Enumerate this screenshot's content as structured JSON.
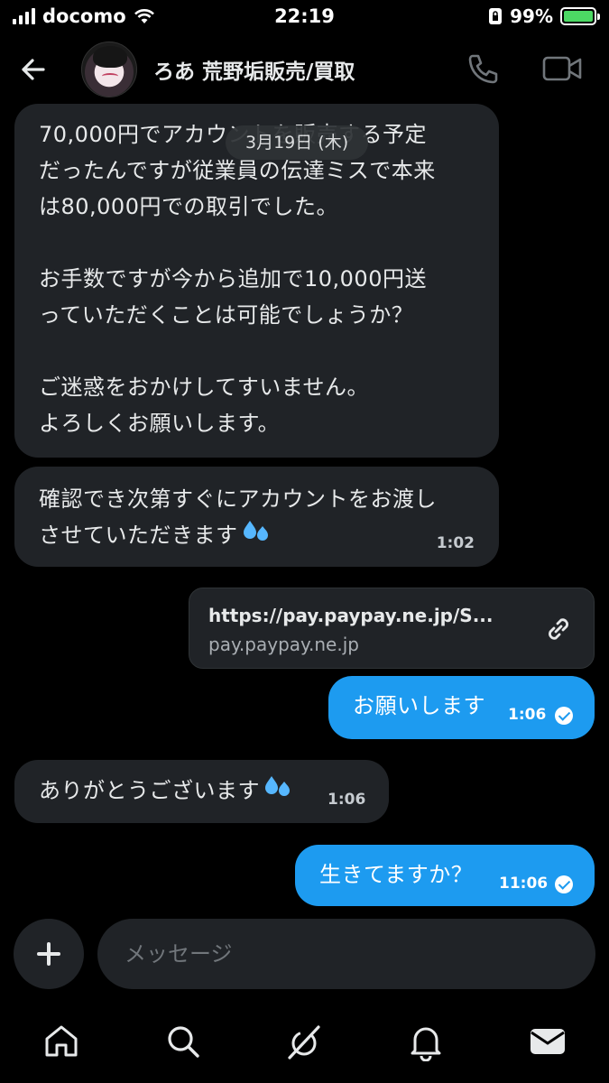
{
  "status_bar": {
    "carrier": "docomo",
    "time": "22:19",
    "battery_percent": "99%"
  },
  "header": {
    "title": "ろあ 荒野垢販売/買取",
    "avatar_icon": "avatar",
    "back_icon": "arrow-left-icon",
    "call_icon": "phone-icon",
    "video_icon": "video-camera-icon"
  },
  "date_separator": "3月19日 (木)",
  "messages": [
    {
      "direction": "incoming",
      "text": "70,000円でアカウントを販売する予定\nだったんですが従業員の伝達ミスで本来\nは80,000円での取引でした。\n\nお手数ですが今から追加で10,000円送\nっていただくことは可能でしょうか？\n\nご迷惑をおかけしてすいません。\nよろしくお願いします。",
      "time": ""
    },
    {
      "direction": "incoming",
      "text": "確認でき次第すぐにアカウントをお渡し\nさせていただきます",
      "emoji": "💦",
      "time": "1:02"
    },
    {
      "direction": "outgoing",
      "type": "link",
      "url": "https://pay.paypay.ne.jp/S...",
      "domain": "pay.paypay.ne.jp",
      "icon": "link-icon"
    },
    {
      "direction": "outgoing",
      "text": "お願いします",
      "time": "1:06",
      "read": true
    },
    {
      "direction": "incoming",
      "text": "ありがとうございます",
      "emoji": "💦",
      "time": "1:06"
    },
    {
      "direction": "outgoing",
      "text": "生きてますか？",
      "time": "11:06",
      "read": true
    }
  ],
  "composer": {
    "placeholder": "メッセージ",
    "add_icon": "plus-icon"
  },
  "tab_bar": [
    {
      "icon": "home-icon"
    },
    {
      "icon": "search-icon"
    },
    {
      "icon": "grok-icon"
    },
    {
      "icon": "bell-icon"
    },
    {
      "icon": "mail-icon",
      "active": true
    }
  ],
  "colors": {
    "background": "#000000",
    "incoming_bubble": "#202327",
    "outgoing_bubble": "#1d9bf0",
    "text": "#e7e9ea",
    "muted": "#71767b"
  }
}
